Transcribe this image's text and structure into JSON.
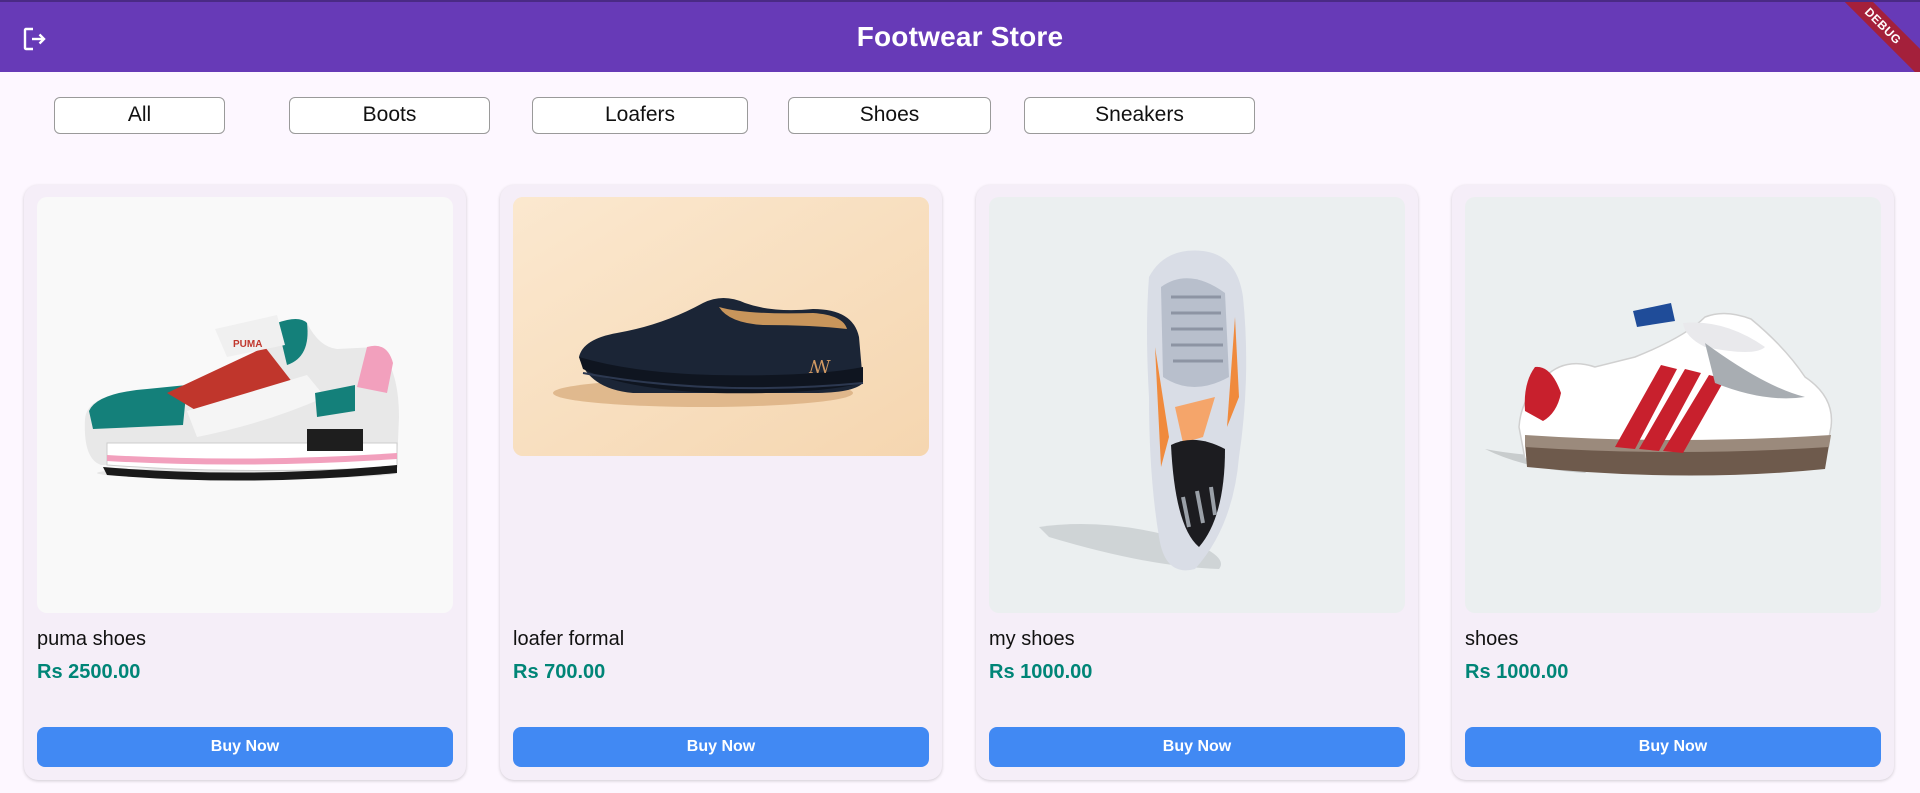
{
  "app_bar": {
    "title": "Footwear Store",
    "logout_icon": "logout-icon",
    "debug_banner": "DEBUG",
    "color": "#673ab7"
  },
  "filters": [
    {
      "label": "All"
    },
    {
      "label": "Boots"
    },
    {
      "label": "Loafers"
    },
    {
      "label": "Shoes"
    },
    {
      "label": "Sneakers"
    }
  ],
  "products": [
    {
      "name": "puma shoes",
      "price": "Rs 2500.00",
      "button": "Buy Now",
      "image": "sneaker-puma-image"
    },
    {
      "name": "loafer formal",
      "price": "Rs 700.00",
      "button": "Buy Now",
      "image": "loafer-image"
    },
    {
      "name": "my shoes",
      "price": "Rs 1000.00",
      "button": "Buy Now",
      "image": "sport-shoe-image"
    },
    {
      "name": "shoes",
      "price": "Rs 1000.00",
      "button": "Buy Now",
      "image": "samba-sneaker-image"
    }
  ],
  "colors": {
    "accent": "#673ab7",
    "price": "#008577",
    "button": "#4189f3",
    "background": "#fdf7ff"
  }
}
